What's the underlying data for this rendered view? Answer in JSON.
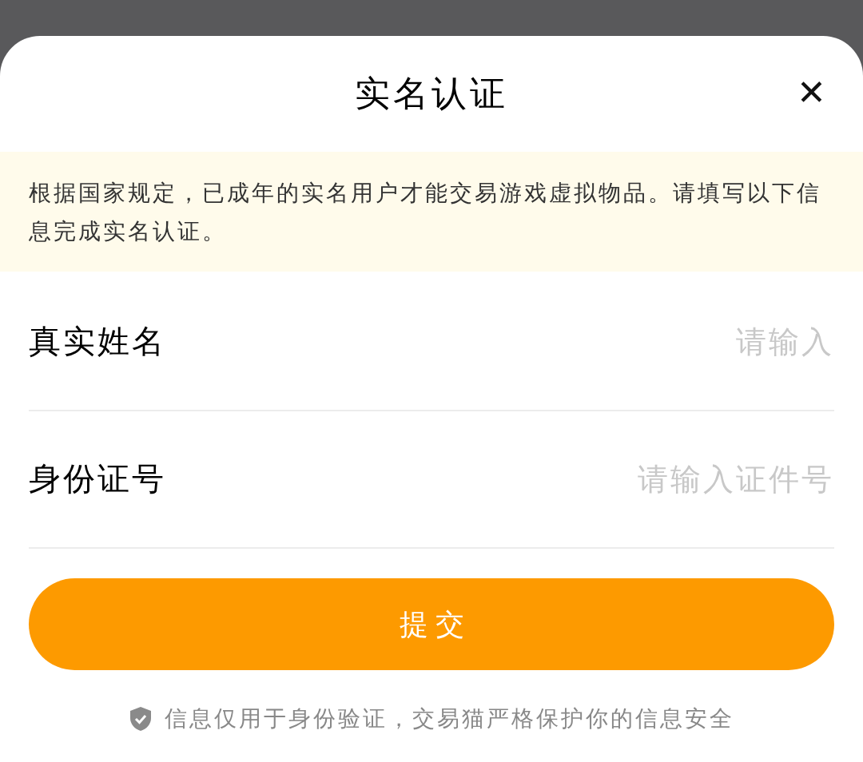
{
  "dialog": {
    "title": "实名认证",
    "close": "✕"
  },
  "notice": "根据国家规定，已成年的实名用户才能交易游戏虚拟物品。请填写以下信息完成实名认证。",
  "fields": [
    {
      "label": "真实姓名",
      "placeholder": "请输入"
    },
    {
      "label": "身份证号",
      "placeholder": "请输入证件号"
    }
  ],
  "submit_button": "提 交",
  "footer": "信息仅用于身份验证，交易猫严格保护你的信息安全"
}
